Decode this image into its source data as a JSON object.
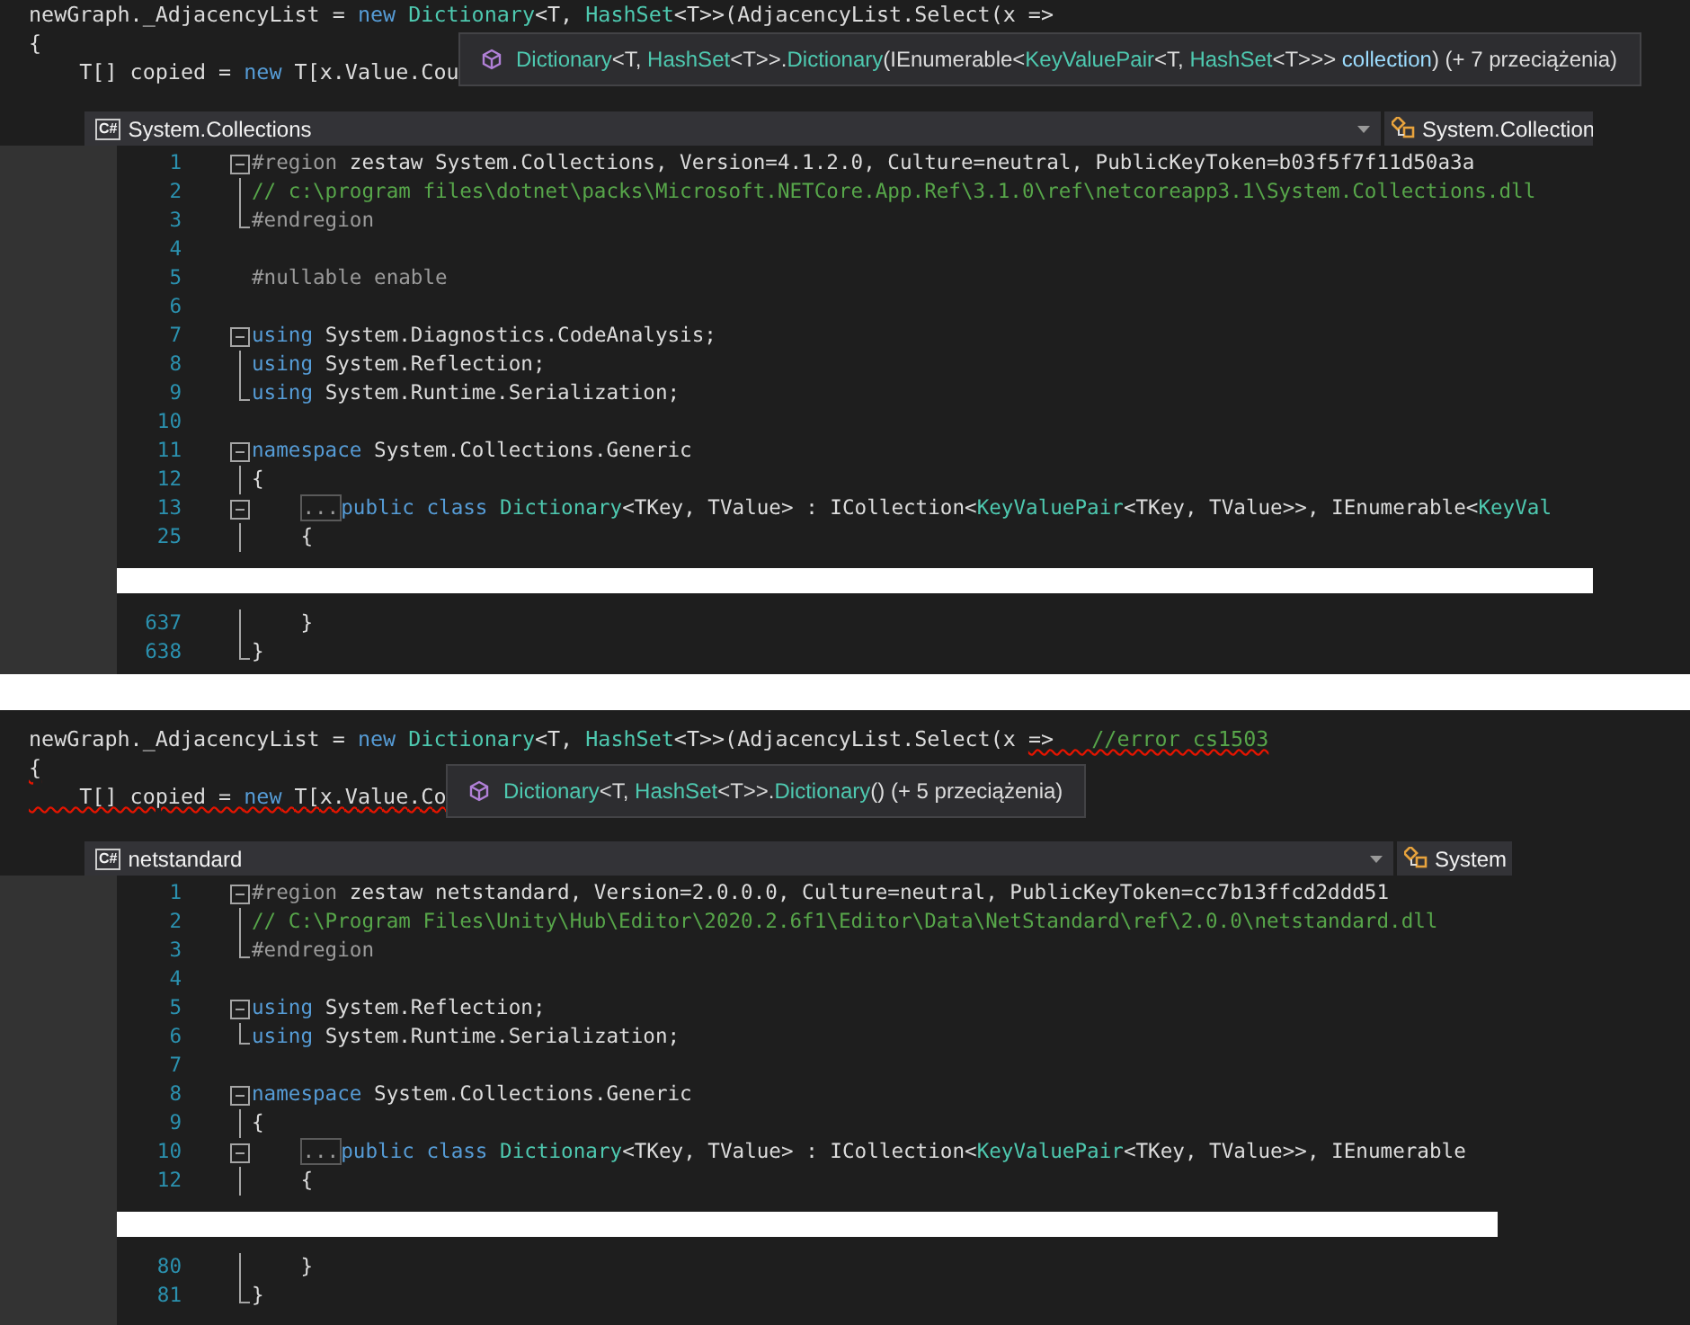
{
  "panels": [
    {
      "source_lines": [
        {
          "segments": [
            {
              "text": "newGraph._AdjacencyList = ",
              "kind": "plain",
              "error": false
            },
            {
              "text": "new",
              "kind": "keyword",
              "error": false
            },
            {
              "text": " Dictionary",
              "kind": "type",
              "error": false
            },
            {
              "text": "<T, ",
              "kind": "plain",
              "error": false
            },
            {
              "text": "HashSet",
              "kind": "type",
              "error": false
            },
            {
              "text": "<T>>(AdjacencyList.Select(x =>",
              "kind": "plain",
              "error": false
            }
          ]
        },
        {
          "segments": [
            {
              "text": "{",
              "kind": "plain",
              "error": false
            }
          ]
        },
        {
          "segments": [
            {
              "text": "    T[] copied = ",
              "kind": "plain",
              "error": false
            },
            {
              "text": "new",
              "kind": "keyword",
              "error": false
            },
            {
              "text": " T[x.Value.Cou",
              "kind": "plain",
              "error": false
            }
          ]
        }
      ],
      "tooltip": {
        "segments": [
          {
            "text": "Dictionary",
            "kind": "type"
          },
          {
            "text": "<T, ",
            "kind": "plain"
          },
          {
            "text": "HashSet",
            "kind": "type"
          },
          {
            "text": "<T>>.",
            "kind": "plain"
          },
          {
            "text": "Dictionary",
            "kind": "type"
          },
          {
            "text": "(IEnumerable<",
            "kind": "plain"
          },
          {
            "text": "KeyValuePair",
            "kind": "type"
          },
          {
            "text": "<T, ",
            "kind": "plain"
          },
          {
            "text": "HashSet",
            "kind": "type"
          },
          {
            "text": "<T>>> ",
            "kind": "plain"
          },
          {
            "text": "collection",
            "kind": "param"
          },
          {
            "text": ") (+ 7 przeciążenia)",
            "kind": "plain"
          }
        ]
      },
      "navbar": {
        "icon_label": "C#",
        "left": "System.Collections",
        "right": "System.Collection"
      },
      "editor": {
        "lines": [
          {
            "kind": "start",
            "number": "1",
            "segments": [
              {
                "text": "#region",
                "kind": "preproc"
              },
              {
                "text": " zestaw System.Collections, Version=4.1.2.0, Culture=neutral, PublicKeyToken=b03f5f7f11d50a3a",
                "kind": "plain"
              }
            ]
          },
          {
            "kind": "inner",
            "number": "2",
            "segments": [
              {
                "text": "// c:\\program files\\dotnet\\packs\\Microsoft.NETCore.App.Ref\\3.1.0\\ref\\netcoreapp3.1\\System.Collections.dll",
                "kind": "comment"
              }
            ]
          },
          {
            "kind": "end",
            "number": "3",
            "segments": [
              {
                "text": "#endregion",
                "kind": "preproc"
              }
            ]
          },
          {
            "kind": "code",
            "number": "4"
          },
          {
            "kind": "code",
            "number": "5",
            "segments": [
              {
                "text": "#nullable enable",
                "kind": "preproc"
              }
            ]
          },
          {
            "kind": "code",
            "number": "6"
          },
          {
            "kind": "start",
            "number": "7",
            "segments": [
              {
                "text": "using",
                "kind": "keyword"
              },
              {
                "text": " System.Diagnostics.CodeAnalysis;",
                "kind": "plain"
              }
            ]
          },
          {
            "kind": "inner",
            "number": "8",
            "segments": [
              {
                "text": "using",
                "kind": "keyword"
              },
              {
                "text": " System.Reflection;",
                "kind": "plain"
              }
            ]
          },
          {
            "kind": "end",
            "number": "9",
            "segments": [
              {
                "text": "using",
                "kind": "keyword"
              },
              {
                "text": " System.Runtime.Serialization;",
                "kind": "plain"
              }
            ]
          },
          {
            "kind": "code",
            "number": "10"
          },
          {
            "kind": "start",
            "number": "11",
            "segments": [
              {
                "text": "namespace",
                "kind": "keyword"
              },
              {
                "text": " System.Collections.Generic",
                "kind": "plain"
              }
            ]
          },
          {
            "kind": "inner",
            "number": "12",
            "segments": [
              {
                "text": "{",
                "kind": "plain"
              }
            ]
          },
          {
            "kind": "start",
            "number": "13",
            "segments": [
              {
                "text": "...",
                "kind": "collapsed"
              },
              {
                "text": "public class",
                "kind": "keyword"
              },
              {
                "text": " Dictionary",
                "kind": "type"
              },
              {
                "text": "<TKey, TValue> : ICollection<",
                "kind": "plain"
              },
              {
                "text": "KeyValuePair",
                "kind": "type"
              },
              {
                "text": "<TKey, TValue>>, IEnumerable<",
                "kind": "plain"
              },
              {
                "text": "KeyVal",
                "kind": "type"
              }
            ]
          },
          {
            "kind": "inner",
            "number": "25",
            "segments": [
              {
                "text": "    {",
                "kind": "plain"
              }
            ]
          },
          {
            "kind": "redacted"
          },
          {
            "kind": "inner",
            "number": "637",
            "segments": [
              {
                "text": "    }",
                "kind": "plain"
              }
            ]
          },
          {
            "kind": "end",
            "number": "638",
            "segments": [
              {
                "text": "}",
                "kind": "plain"
              }
            ]
          }
        ]
      }
    },
    {
      "source_lines": [
        {
          "segments": [
            {
              "text": "newGraph._AdjacencyList = ",
              "kind": "plain",
              "error": false
            },
            {
              "text": "new",
              "kind": "keyword",
              "error": false
            },
            {
              "text": " Dictionary",
              "kind": "type",
              "error": false
            },
            {
              "text": "<T, ",
              "kind": "plain",
              "error": false
            },
            {
              "text": "HashSet",
              "kind": "type",
              "error": false
            },
            {
              "text": "<T>>(AdjacencyList.Select(x ",
              "kind": "plain",
              "error": false
            },
            {
              "text": "=>   ",
              "kind": "plain",
              "error": true
            },
            {
              "text": "//error cs1503",
              "kind": "comment",
              "error": true
            }
          ]
        },
        {
          "segments": [
            {
              "text": "{",
              "kind": "plain",
              "error": true
            }
          ]
        },
        {
          "segments": [
            {
              "text": "    T[] copied = ",
              "kind": "plain",
              "error": true
            },
            {
              "text": "new",
              "kind": "keyword",
              "error": true
            },
            {
              "text": " T[x.Value.Co",
              "kind": "plain",
              "error": true
            }
          ]
        }
      ],
      "tooltip": {
        "segments": [
          {
            "text": "Dictionary",
            "kind": "type"
          },
          {
            "text": "<T, ",
            "kind": "plain"
          },
          {
            "text": "HashSet",
            "kind": "type"
          },
          {
            "text": "<T>>.",
            "kind": "plain"
          },
          {
            "text": "Dictionary",
            "kind": "type"
          },
          {
            "text": "() (+ 5 przeciążenia)",
            "kind": "plain"
          }
        ]
      },
      "navbar": {
        "icon_label": "C#",
        "left": "netstandard",
        "right": "System"
      },
      "editor": {
        "lines": [
          {
            "kind": "start",
            "number": "1",
            "segments": [
              {
                "text": "#region",
                "kind": "preproc"
              },
              {
                "text": " zestaw netstandard, Version=2.0.0.0, Culture=neutral, PublicKeyToken=cc7b13ffcd2ddd51",
                "kind": "plain"
              }
            ]
          },
          {
            "kind": "inner",
            "number": "2",
            "segments": [
              {
                "text": "// C:\\Program Files\\Unity\\Hub\\Editor\\2020.2.6f1\\Editor\\Data\\NetStandard\\ref\\2.0.0\\netstandard.dll",
                "kind": "comment"
              }
            ]
          },
          {
            "kind": "end",
            "number": "3",
            "segments": [
              {
                "text": "#endregion",
                "kind": "preproc"
              }
            ]
          },
          {
            "kind": "code",
            "number": "4"
          },
          {
            "kind": "start",
            "number": "5",
            "segments": [
              {
                "text": "using",
                "kind": "keyword"
              },
              {
                "text": " System.Reflection;",
                "kind": "plain"
              }
            ]
          },
          {
            "kind": "end",
            "number": "6",
            "segments": [
              {
                "text": "using",
                "kind": "keyword"
              },
              {
                "text": " System.Runtime.Serialization;",
                "kind": "plain"
              }
            ]
          },
          {
            "kind": "code",
            "number": "7"
          },
          {
            "kind": "start",
            "number": "8",
            "segments": [
              {
                "text": "namespace",
                "kind": "keyword"
              },
              {
                "text": " System.Collections.Generic",
                "kind": "plain"
              }
            ]
          },
          {
            "kind": "inner",
            "number": "9",
            "segments": [
              {
                "text": "{",
                "kind": "plain"
              }
            ]
          },
          {
            "kind": "start",
            "number": "10",
            "segments": [
              {
                "text": "...",
                "kind": "collapsed"
              },
              {
                "text": "public class",
                "kind": "keyword"
              },
              {
                "text": " Dictionary",
                "kind": "type"
              },
              {
                "text": "<TKey, TValue> : ICollection<",
                "kind": "plain"
              },
              {
                "text": "KeyValuePair",
                "kind": "type"
              },
              {
                "text": "<TKey, TValue>>, IEnumerable",
                "kind": "plain"
              }
            ]
          },
          {
            "kind": "inner",
            "number": "12",
            "segments": [
              {
                "text": "    {",
                "kind": "plain"
              }
            ]
          },
          {
            "kind": "redacted"
          },
          {
            "kind": "inner",
            "number": "80",
            "segments": [
              {
                "text": "    }",
                "kind": "plain"
              }
            ]
          },
          {
            "kind": "end",
            "number": "81",
            "segments": [
              {
                "text": "}",
                "kind": "plain"
              }
            ]
          }
        ]
      }
    }
  ]
}
